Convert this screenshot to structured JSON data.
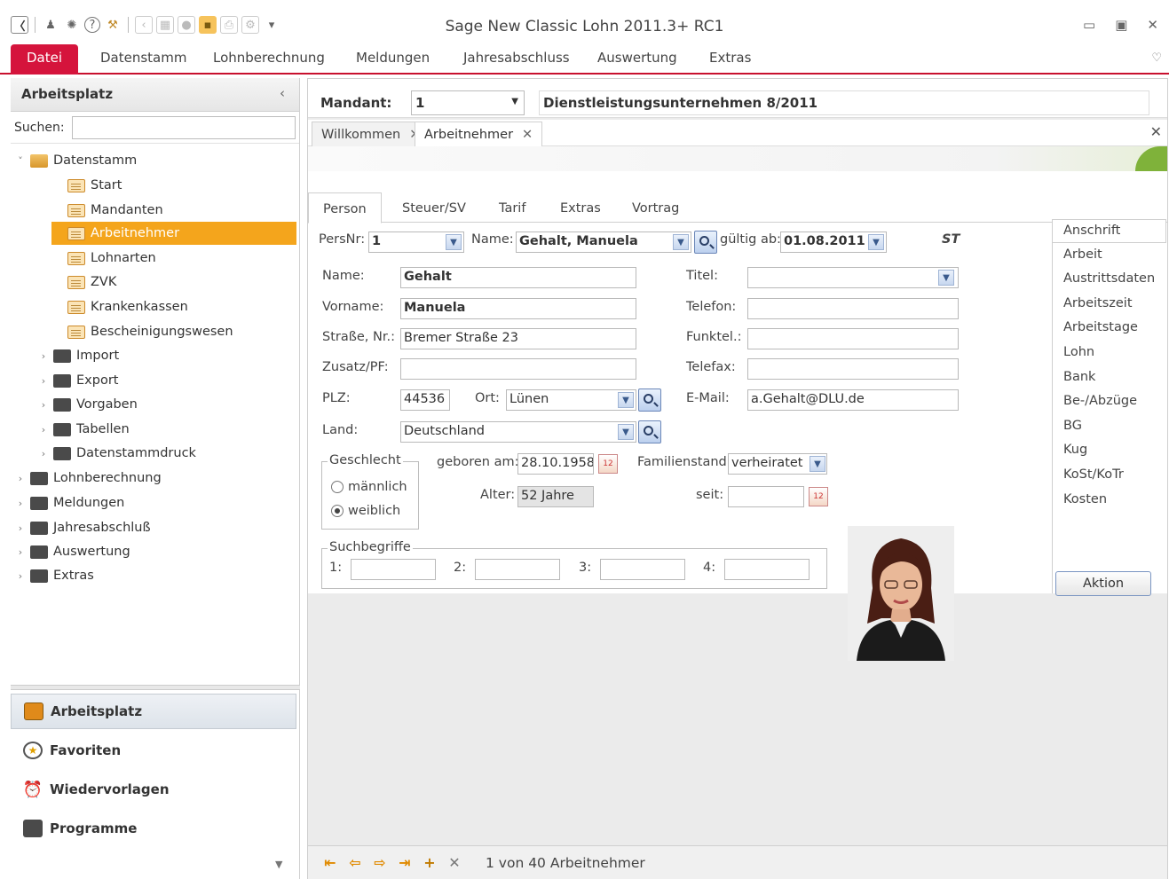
{
  "window": {
    "title": "Sage New Classic Lohn 2011.3+ RC1",
    "minimize": "▭",
    "restore": "▣",
    "close": "✕"
  },
  "ribbon": {
    "tabs": [
      "Datei",
      "Datenstamm",
      "Lohnberechnung",
      "Meldungen",
      "Jahresabschluss",
      "Auswertung",
      "Extras"
    ],
    "active_tab": "Datei"
  },
  "left_pane": {
    "title": "Arbeitsplatz",
    "collapse_glyph": "‹",
    "search_label": "Suchen:",
    "search_value": "",
    "tree": [
      {
        "label": "Datenstamm",
        "type": "open",
        "expanded": true
      },
      {
        "label": "Start",
        "type": "doc"
      },
      {
        "label": "Mandanten",
        "type": "doc"
      },
      {
        "label": "Arbeitnehmer",
        "type": "doc",
        "selected": true
      },
      {
        "label": "Lohnarten",
        "type": "doc"
      },
      {
        "label": "ZVK",
        "type": "doc"
      },
      {
        "label": "Krankenkassen",
        "type": "doc"
      },
      {
        "label": "Bescheinigungswesen",
        "type": "doc"
      },
      {
        "label": "Import",
        "type": "dark"
      },
      {
        "label": "Export",
        "type": "dark"
      },
      {
        "label": "Vorgaben",
        "type": "dark"
      },
      {
        "label": "Tabellen",
        "type": "dark"
      },
      {
        "label": "Datenstammdruck",
        "type": "dark"
      },
      {
        "label": "Lohnberechnung",
        "type": "dark"
      },
      {
        "label": "Meldungen",
        "type": "dark"
      },
      {
        "label": "Jahresabschluß",
        "type": "dark"
      },
      {
        "label": "Auswertung",
        "type": "dark"
      },
      {
        "label": "Extras",
        "type": "dark"
      }
    ],
    "nav_buttons": [
      {
        "label": "Arbeitsplatz",
        "icon": "monitor-icon",
        "active": true
      },
      {
        "label": "Favoriten",
        "icon": "star-icon"
      },
      {
        "label": "Wiedervorlagen",
        "icon": "alarm-clock-icon"
      },
      {
        "label": "Programme",
        "icon": "folder-icon"
      }
    ]
  },
  "mandant": {
    "label": "Mandant:",
    "value": "1",
    "company": "Dienstleistungsunternehmen 8/2011"
  },
  "doc_tabs": [
    {
      "label": "Willkommen"
    },
    {
      "label": "Arbeitnehmer",
      "active": true
    }
  ],
  "form": {
    "subtabs": [
      "Person",
      "Steuer/SV",
      "Tarif",
      "Extras",
      "Vortrag"
    ],
    "active_subtab": "Person",
    "persnr_label": "PersNr:",
    "persnr_value": "1",
    "name_lookup_label": "Name:",
    "name_lookup_value": "Gehalt, Manuela",
    "gueltig_label": "gültig ab:",
    "gueltig_value": "01.08.2011",
    "st_badge": "ST",
    "name_label": "Name:",
    "name_value": "Gehalt",
    "vorname_label": "Vorname:",
    "vorname_value": "Manuela",
    "strasse_label": "Straße, Nr.:",
    "strasse_value": "Bremer Straße 23",
    "zusatz_label": "Zusatz/PF:",
    "zusatz_value": "",
    "plz_label": "PLZ:",
    "plz_value": "44536",
    "ort_label": "Ort:",
    "ort_value": "Lünen",
    "land_label": "Land:",
    "land_value": "Deutschland",
    "titel_label": "Titel:",
    "titel_value": "",
    "telefon_label": "Telefon:",
    "telefon_value": "",
    "funktel_label": "Funktel.:",
    "funktel_value": "",
    "telefax_label": "Telefax:",
    "telefax_value": "",
    "email_label": "E-Mail:",
    "email_value": "a.Gehalt@DLU.de",
    "geschlecht_label": "Geschlecht",
    "maennlich_label": "männlich",
    "weiblich_label": "weiblich",
    "geschlecht_selected": "weiblich",
    "geboren_label": "geboren am:",
    "geboren_value": "28.10.1958",
    "alter_label": "Alter:",
    "alter_value": "52 Jahre",
    "familienstand_label": "Familienstand:",
    "familienstand_value": "verheiratet",
    "seit_label": "seit:",
    "seit_value": "",
    "suchbegriffe_label": "Suchbegriffe",
    "suchbegriffe": [
      {
        "label": "1:",
        "value": ""
      },
      {
        "label": "2:",
        "value": ""
      },
      {
        "label": "3:",
        "value": ""
      },
      {
        "label": "4:",
        "value": ""
      }
    ]
  },
  "side_nav": {
    "items": [
      "Anschrift",
      "Arbeit",
      "Austrittsdaten",
      "Arbeitszeit",
      "Arbeitstage",
      "Lohn",
      "Bank",
      "Be-/Abzüge",
      "BG",
      "Kug",
      "KoSt/KoTr",
      "Kosten"
    ],
    "active": "Anschrift",
    "action_label": "Aktion"
  },
  "status_bar": {
    "record_count": "1 von 40 Arbeitnehmer"
  },
  "colors": {
    "accent_red": "#d5143c",
    "selection_orange": "#f4a51c"
  }
}
